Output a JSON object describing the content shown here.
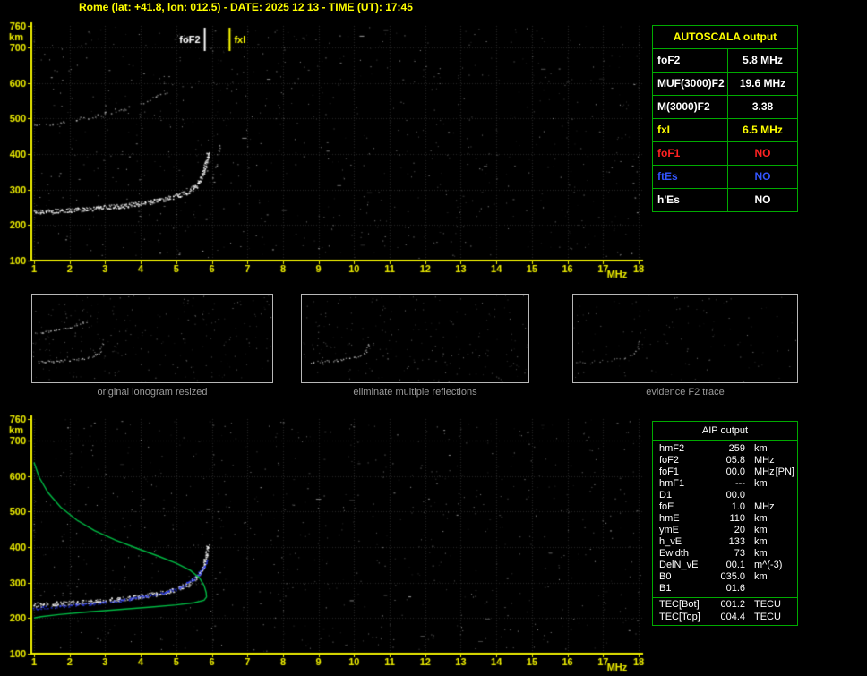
{
  "title": "Rome (lat: +41.8, lon: 012.5) - DATE: 2025 12 13 - TIME (UT): 17:45",
  "colors": {
    "axis": "#f0f000",
    "grid": "#262626",
    "trace": "#ffffff",
    "noise": "#c8c8c8",
    "profile_green": "#00bb44",
    "restored_blue": "#2a3cff",
    "table_border": "#00aa00",
    "marker_fof2": "#ffffff",
    "marker_fxi": "#ffff00",
    "thumb_label": "#9a9a9a"
  },
  "autoscala_table": {
    "title": "AUTOSCALA output",
    "rows": [
      {
        "label": "foF2",
        "value": "5.8 MHz",
        "color": "#ffffff"
      },
      {
        "label": "MUF(3000)F2",
        "value": "19.6 MHz",
        "color": "#ffffff"
      },
      {
        "label": "M(3000)F2",
        "value": "3.38",
        "color": "#ffffff"
      },
      {
        "label": "fxI",
        "value": "6.5 MHz",
        "color": "#ffff00"
      },
      {
        "label": "foF1",
        "value": "NO",
        "color": "#ff2222"
      },
      {
        "label": "ftEs",
        "value": "NO",
        "color": "#3355ff"
      },
      {
        "label": "h'Es",
        "value": "NO",
        "color": "#ffffff"
      }
    ]
  },
  "aip_table": {
    "title": "AIP output",
    "rows": [
      {
        "name": "hmF2",
        "value": "259",
        "unit": "km"
      },
      {
        "name": "foF2",
        "value": "05.8",
        "unit": "MHz"
      },
      {
        "name": "foF1",
        "value": "00.0",
        "unit": "MHz",
        "note": "[PN]"
      },
      {
        "name": "hmF1",
        "value": "---",
        "unit": "km"
      },
      {
        "name": "D1",
        "value": "00.0",
        "unit": ""
      },
      {
        "name": "foE",
        "value": "1.0",
        "unit": "MHz"
      },
      {
        "name": "hmE",
        "value": "110",
        "unit": "km"
      },
      {
        "name": "ymE",
        "value": "20",
        "unit": "km"
      },
      {
        "name": "h_vE",
        "value": "133",
        "unit": "km"
      },
      {
        "name": "Ewidth",
        "value": "73",
        "unit": "km"
      },
      {
        "name": "DelN_vE",
        "value": "00.1",
        "unit": "m^(-3)"
      },
      {
        "name": "B0",
        "value": "035.0",
        "unit": "km"
      },
      {
        "name": "B1",
        "value": "01.6",
        "unit": ""
      },
      {
        "name": "TEC[Bot]",
        "value": "001.2",
        "unit": "TECU",
        "sep": true
      },
      {
        "name": "TEC[Top]",
        "value": "004.4",
        "unit": "TECU"
      }
    ]
  },
  "thumbnails": [
    {
      "label": "original ionogram resized",
      "series": [
        0,
        1
      ],
      "noise": 260,
      "faint": false
    },
    {
      "label": "eliminate multiple reflections",
      "series": [
        0
      ],
      "noise": 220,
      "faint": false
    },
    {
      "label": "evidence F2 trace",
      "series": [
        0
      ],
      "noise": 120,
      "faint": true
    }
  ],
  "chart_data": [
    {
      "id": "top-ionogram",
      "type": "scatter",
      "title": "recorded ionogram with scaled characteristics",
      "xlabel": "MHz",
      "ylabel": "km",
      "xlim": [
        1,
        18
      ],
      "ylim": [
        100,
        760
      ],
      "xticks": [
        1,
        2,
        3,
        4,
        5,
        6,
        7,
        8,
        9,
        10,
        11,
        12,
        13,
        14,
        15,
        16,
        17,
        18
      ],
      "yticks": [
        760,
        700,
        600,
        500,
        400,
        300,
        200,
        100
      ],
      "grid": true,
      "noise_dots": 780,
      "markers": [
        {
          "label": "foF2",
          "freq": 5.8,
          "color": "#ffffff",
          "label_side": "left"
        },
        {
          "label": "fxI",
          "freq": 6.5,
          "color": "#ffff00",
          "label_side": "right"
        }
      ],
      "series": [
        {
          "name": "F2-trace",
          "color": "#ffffff",
          "style": "fuzzy-thick",
          "points": [
            [
              1.0,
              238
            ],
            [
              1.6,
              241
            ],
            [
              2.2,
              244
            ],
            [
              2.8,
              249
            ],
            [
              3.4,
              254
            ],
            [
              3.9,
              260
            ],
            [
              4.4,
              268
            ],
            [
              4.8,
              277
            ],
            [
              5.1,
              286
            ],
            [
              5.35,
              297
            ],
            [
              5.55,
              312
            ],
            [
              5.68,
              330
            ],
            [
              5.78,
              355
            ],
            [
              5.84,
              382
            ],
            [
              5.88,
              405
            ]
          ]
        },
        {
          "name": "second-hop-echo",
          "color": "#dddddd",
          "style": "fuzzy-sparse",
          "points": [
            [
              1.0,
              478
            ],
            [
              1.5,
              486
            ],
            [
              2.0,
              494
            ],
            [
              2.5,
              504
            ],
            [
              3.0,
              515
            ],
            [
              3.5,
              528
            ],
            [
              4.0,
              543
            ],
            [
              4.4,
              558
            ],
            [
              4.7,
              572
            ]
          ]
        },
        {
          "name": "x-mode-tail",
          "color": "#cccccc",
          "style": "fuzzy-sparse",
          "points": [
            [
              6.02,
              335
            ],
            [
              6.08,
              360
            ],
            [
              6.14,
              392
            ],
            [
              6.2,
              428
            ]
          ]
        }
      ]
    },
    {
      "id": "bottom-ionogram",
      "type": "scatter",
      "title": "ionogram with restored trace and electron density profile",
      "xlabel": "MHz",
      "ylabel": "km",
      "xlim": [
        1,
        18
      ],
      "ylim": [
        100,
        760
      ],
      "xticks": [
        1,
        2,
        3,
        4,
        5,
        6,
        7,
        8,
        9,
        10,
        11,
        12,
        13,
        14,
        15,
        16,
        17,
        18
      ],
      "yticks": [
        760,
        700,
        600,
        500,
        400,
        300,
        200,
        100
      ],
      "grid": true,
      "noise_dots": 700,
      "markers": [],
      "series": [
        {
          "name": "F2-trace",
          "color": "#ffffff",
          "style": "fuzzy-thick",
          "points": [
            [
              1.0,
              238
            ],
            [
              1.6,
              241
            ],
            [
              2.2,
              244
            ],
            [
              2.8,
              249
            ],
            [
              3.4,
              254
            ],
            [
              3.9,
              260
            ],
            [
              4.4,
              268
            ],
            [
              4.8,
              277
            ],
            [
              5.1,
              286
            ],
            [
              5.35,
              297
            ],
            [
              5.55,
              312
            ],
            [
              5.68,
              330
            ],
            [
              5.78,
              355
            ],
            [
              5.84,
              382
            ],
            [
              5.88,
              405
            ]
          ]
        },
        {
          "name": "restored-trace",
          "color": "#2a3cff",
          "style": "fuzzy-thin",
          "points": [
            [
              1.0,
              228
            ],
            [
              1.8,
              234
            ],
            [
              2.6,
              241
            ],
            [
              3.4,
              250
            ],
            [
              4.1,
              261
            ],
            [
              4.7,
              274
            ],
            [
              5.15,
              289
            ],
            [
              5.45,
              307
            ],
            [
              5.65,
              327
            ],
            [
              5.78,
              347
            ],
            [
              5.85,
              362
            ]
          ]
        },
        {
          "name": "electron-density-profile",
          "color": "#00bb44",
          "style": "line",
          "points": [
            [
              1.0,
              638
            ],
            [
              1.15,
              595
            ],
            [
              1.4,
              552
            ],
            [
              1.75,
              512
            ],
            [
              2.2,
              476
            ],
            [
              2.7,
              446
            ],
            [
              3.3,
              419
            ],
            [
              3.9,
              396
            ],
            [
              4.5,
              374
            ],
            [
              5.0,
              354
            ],
            [
              5.4,
              334
            ],
            [
              5.65,
              313
            ],
            [
              5.78,
              292
            ],
            [
              5.84,
              272
            ],
            [
              5.85,
              259
            ],
            [
              5.78,
              250
            ],
            [
              5.5,
              243
            ],
            [
              5.0,
              237
            ],
            [
              4.3,
              231
            ],
            [
              3.4,
              224
            ],
            [
              2.5,
              217
            ],
            [
              1.7,
              210
            ],
            [
              1.2,
              204
            ],
            [
              1.0,
              200
            ]
          ]
        }
      ]
    }
  ]
}
